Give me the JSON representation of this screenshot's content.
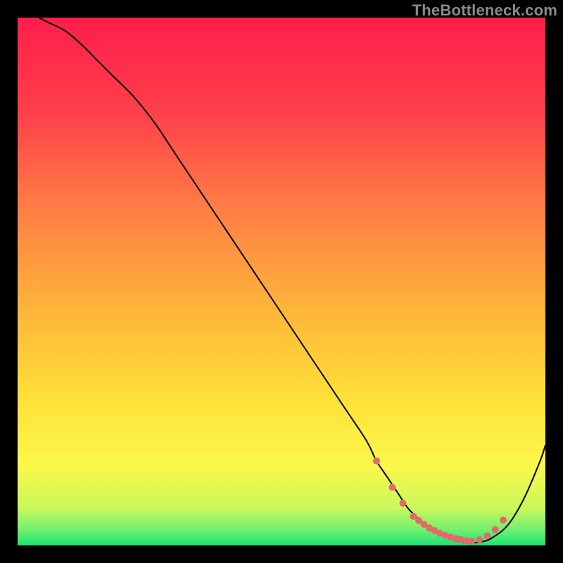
{
  "watermark": "TheBottleneck.com",
  "chart_data": {
    "type": "line",
    "title": "",
    "xlabel": "",
    "ylabel": "",
    "xlim": [
      0,
      100
    ],
    "ylim": [
      0,
      100
    ],
    "grid": false,
    "legend": false,
    "background_gradient": {
      "stops": [
        {
          "offset": 0,
          "color": "#ff1e4a"
        },
        {
          "offset": 18,
          "color": "#ff3f4a"
        },
        {
          "offset": 35,
          "color": "#ff7a45"
        },
        {
          "offset": 55,
          "color": "#ffb43a"
        },
        {
          "offset": 72,
          "color": "#ffe039"
        },
        {
          "offset": 85,
          "color": "#fbf84a"
        },
        {
          "offset": 93,
          "color": "#c9f85b"
        },
        {
          "offset": 97,
          "color": "#73ef6e"
        },
        {
          "offset": 100,
          "color": "#18e574"
        }
      ]
    },
    "series": [
      {
        "name": "bottleneck-curve",
        "color": "#000000",
        "width": 2,
        "x": [
          4,
          6,
          9,
          12,
          15,
          18,
          22,
          26,
          30,
          34,
          38,
          42,
          46,
          50,
          54,
          58,
          62,
          66,
          68,
          70,
          72,
          74,
          76,
          78,
          80,
          82,
          84,
          86,
          88,
          90,
          93,
          96,
          99,
          100
        ],
        "y": [
          100,
          99,
          97.5,
          95,
          92,
          89,
          85,
          80,
          74,
          68,
          62,
          56,
          50,
          44,
          38,
          32,
          26,
          20,
          16,
          13,
          10,
          7,
          5,
          3.5,
          2.2,
          1.3,
          0.7,
          0.5,
          0.7,
          1.5,
          4,
          9,
          16,
          19
        ]
      },
      {
        "name": "highlight-dots",
        "type": "scatter",
        "color": "#e46a6a",
        "radius": 5,
        "x": [
          68,
          71,
          73,
          75,
          76,
          77,
          78,
          79,
          80,
          81,
          82,
          83,
          84,
          85,
          86,
          87.5,
          89,
          90.5,
          92
        ],
        "y": [
          16,
          11,
          8,
          5.5,
          4.7,
          4,
          3.3,
          2.8,
          2.3,
          1.9,
          1.6,
          1.3,
          1.1,
          0.9,
          0.8,
          1.1,
          1.8,
          3,
          4.8
        ]
      }
    ]
  }
}
